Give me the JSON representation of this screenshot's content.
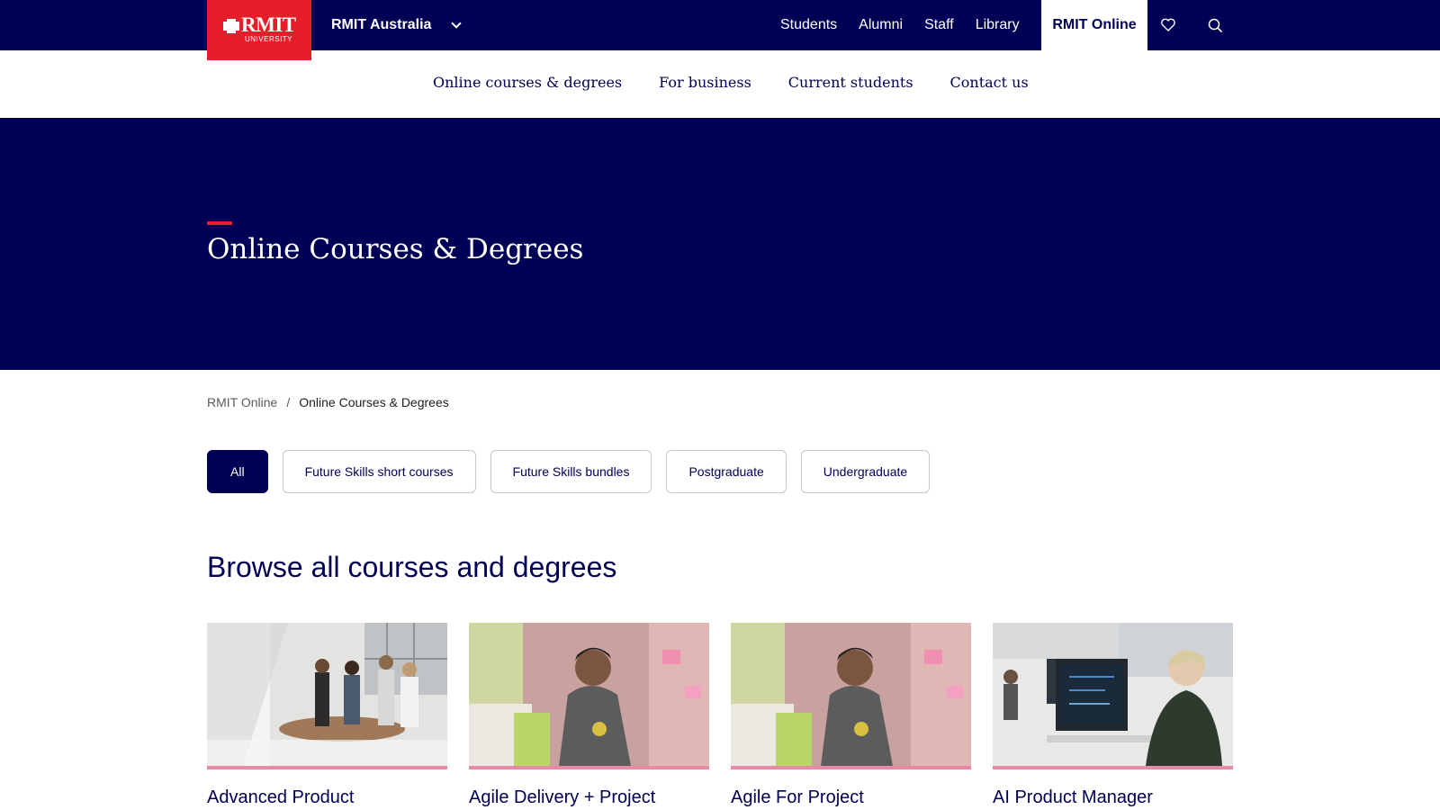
{
  "header": {
    "logo": {
      "wordmark": "RMIT",
      "sub": "UNIVERSITY"
    },
    "site_switcher": "RMIT Australia",
    "utility_links": [
      "Students",
      "Alumni",
      "Staff",
      "Library"
    ],
    "active_site": "RMIT Online",
    "icons": {
      "favourites": "heart-icon",
      "search": "search-icon",
      "switcher": "chevron-down-icon"
    }
  },
  "subnav": {
    "items": [
      "Online courses & degrees",
      "For business",
      "Current students",
      "Contact us"
    ]
  },
  "hero": {
    "title": "Online Courses & Degrees"
  },
  "breadcrumb": {
    "parent": "RMIT Online",
    "separator": "/",
    "current": "Online Courses & Degrees"
  },
  "filters": {
    "selected": "All",
    "options": [
      "All",
      "Future Skills short courses",
      "Future Skills bundles",
      "Postgraduate",
      "Undergraduate"
    ]
  },
  "browse": {
    "title": "Browse all courses and degrees",
    "cards": [
      {
        "title": "Advanced Product Management"
      },
      {
        "title": "Agile Delivery + Project Management"
      },
      {
        "title": "Agile For Project Management"
      },
      {
        "title": "AI Product Manager"
      }
    ]
  },
  "colors": {
    "navy": "#000054",
    "red": "#e61e2a",
    "pink_accent": "#e88aa6"
  }
}
